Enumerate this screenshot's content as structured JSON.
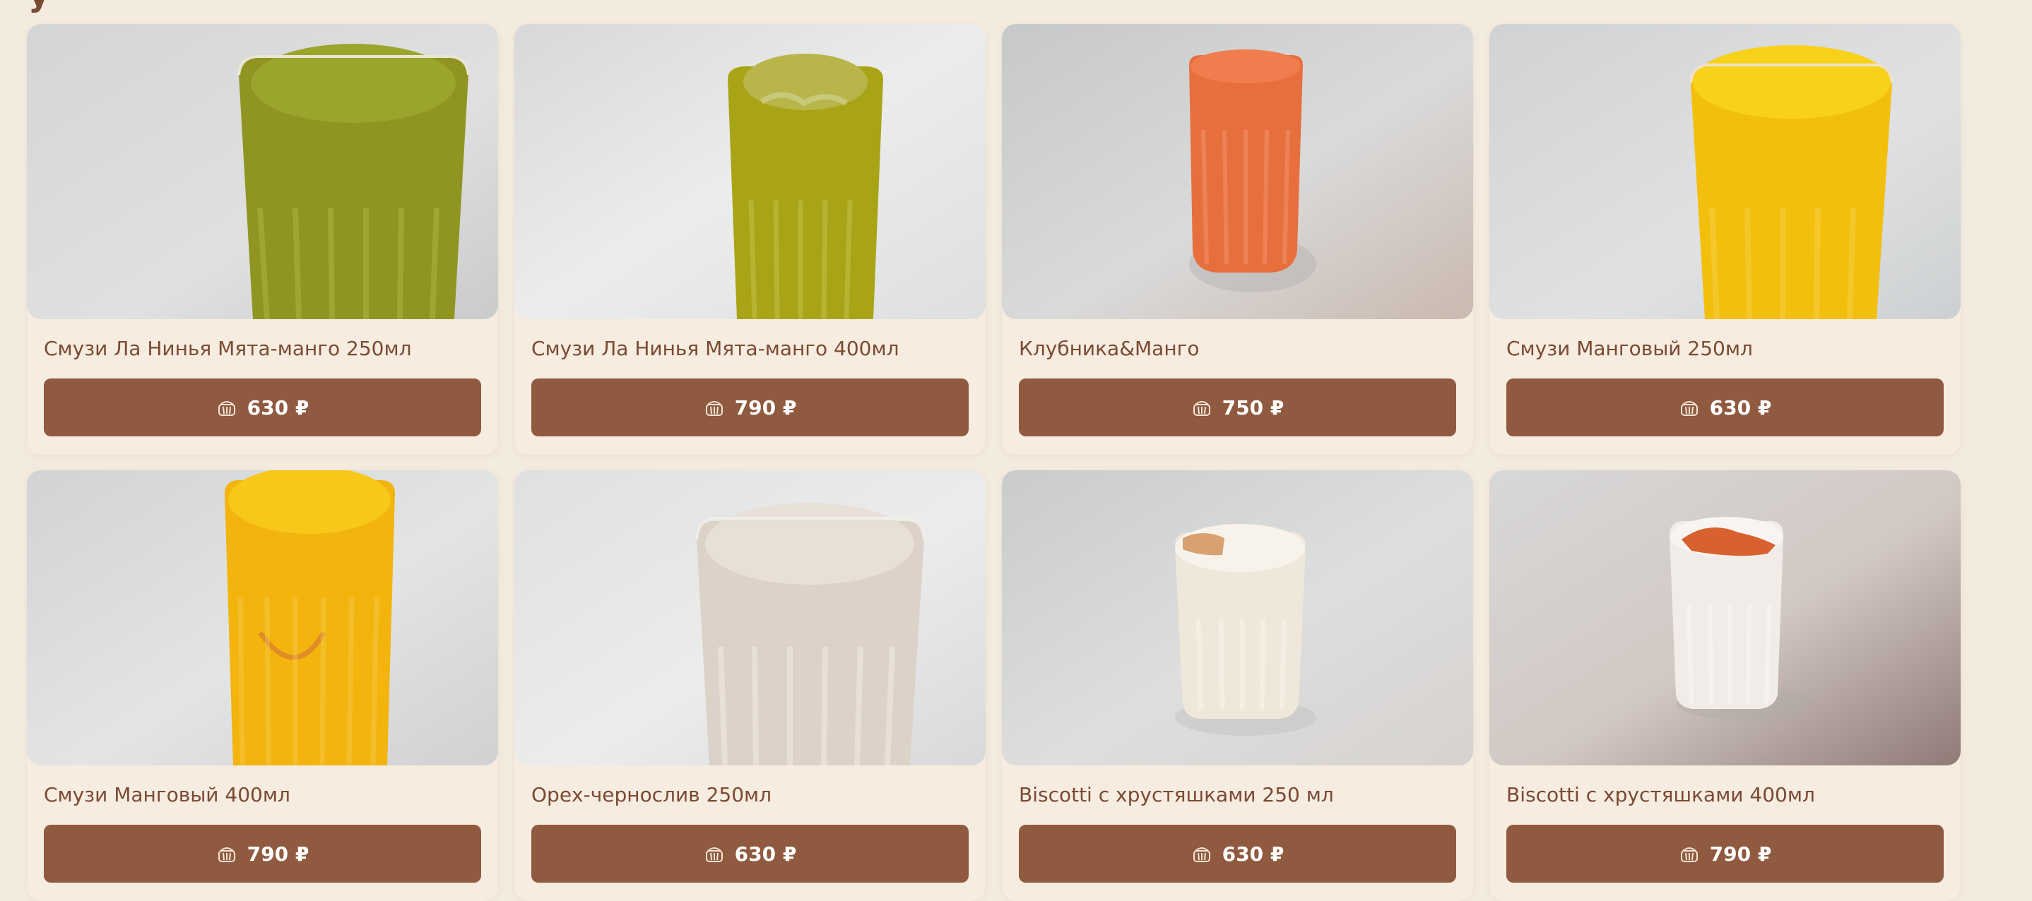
{
  "colors": {
    "background": "#f4ebdf",
    "card": "#f6ece0",
    "accent": "#8f5a3f",
    "title_text": "#7b4a33"
  },
  "products": [
    {
      "name": "Смузи Ла Нинья Мята-манго 250мл",
      "price": "630 ₽",
      "icon": "basket-icon",
      "drink_color": "#8b9418"
    },
    {
      "name": "Смузи Ла Нинья Мята-манго 400мл",
      "price": "790 ₽",
      "icon": "basket-icon",
      "drink_color": "#a7a316"
    },
    {
      "name": "Клубника&Манго",
      "price": "750 ₽",
      "icon": "basket-icon",
      "drink_color": "#e76f3e"
    },
    {
      "name": "Смузи Манговый 250мл",
      "price": "630 ₽",
      "icon": "basket-icon",
      "drink_color": "#f4bc0d"
    },
    {
      "name": "Смузи Манговый 400мл",
      "price": "790 ₽",
      "icon": "basket-icon",
      "drink_color": "#f3b80d"
    },
    {
      "name": "Орех-чернослив 250мл",
      "price": "630 ₽",
      "icon": "basket-icon",
      "drink_color": "#ddd2c8"
    },
    {
      "name": "Biscotti с хрустяшками 250 мл",
      "price": "630 ₽",
      "icon": "basket-icon",
      "drink_color": "#eee7d9"
    },
    {
      "name": "Biscotti с хрустяшками 400мл",
      "price": "790 ₽",
      "icon": "basket-icon",
      "drink_color": "#f1ece8"
    }
  ]
}
